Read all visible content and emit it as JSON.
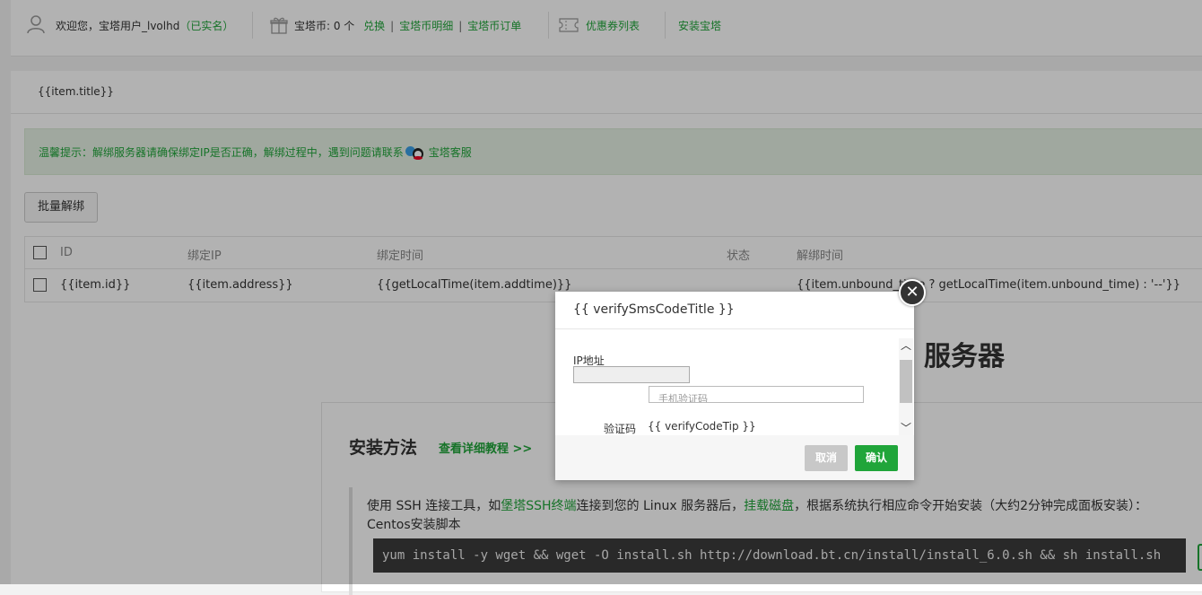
{
  "topbar": {
    "welcome": "欢迎您，宝塔用户_lvolhd",
    "verified": "（已实名）",
    "coin_label": "宝塔币: 0 个",
    "exchange": "兑换",
    "coin_detail": "宝塔币明细",
    "coin_orders": "宝塔币订单",
    "coupons": "优惠券列表",
    "install_bt": "安装宝塔",
    "sep": "|"
  },
  "panel": {
    "title": "{{item.title}}",
    "tip": "温馨提示：解绑服务器请确保绑定IP是否正确，解绑过程中，遇到问题请联系",
    "support_link": "宝塔客服",
    "batch_unbind": "批量解绑"
  },
  "table": {
    "headers": [
      "ID",
      "绑定IP",
      "绑定时间",
      "状态",
      "解绑时间"
    ],
    "row": [
      "{{item.id}}",
      "{{item.address}}",
      "{{getLocalTime(item.addtime)}}",
      "",
      "{{item.unbound_time ? getLocalTime(item.unbound_time) : '--'}}"
    ]
  },
  "heading_fragment": "服务器",
  "install": {
    "title": "安装方法",
    "tutorial_link": "查看详细教程 >>",
    "desc_pre": "使用 SSH 连接工具，如",
    "ssh_link": "堡塔SSH终端",
    "desc_mid": "连接到您的 Linux 服务器后，",
    "mount_link": "挂载磁盘",
    "desc_post": "，根据系统执行相应命令开始安装（大约2分钟完成面板安装）：",
    "os_label": "Centos安装脚本",
    "command": "yum install -y wget && wget -O install.sh http://download.bt.cn/install/install_6.0.sh && sh install.sh"
  },
  "dialog": {
    "title": "{{ verifySmsCodeTitle }}",
    "ip_label": "IP地址",
    "phone_placeholder": "手机验证码",
    "code_label": "验证码",
    "code_tip": "{{ verifyCodeTip }}",
    "cancel": "取消",
    "confirm": "确认",
    "close_glyph": "✕",
    "scroll_up": "︿",
    "scroll_down": "﹀"
  },
  "colors": {
    "accent": "#20a53a",
    "tip_bg": "#e6f1e4",
    "overlay": "rgba(0,0,0,0.3)"
  },
  "icons": [
    "user-icon",
    "gift-icon",
    "coupon-icon",
    "qq-icon",
    "close-icon",
    "copy-icon"
  ]
}
